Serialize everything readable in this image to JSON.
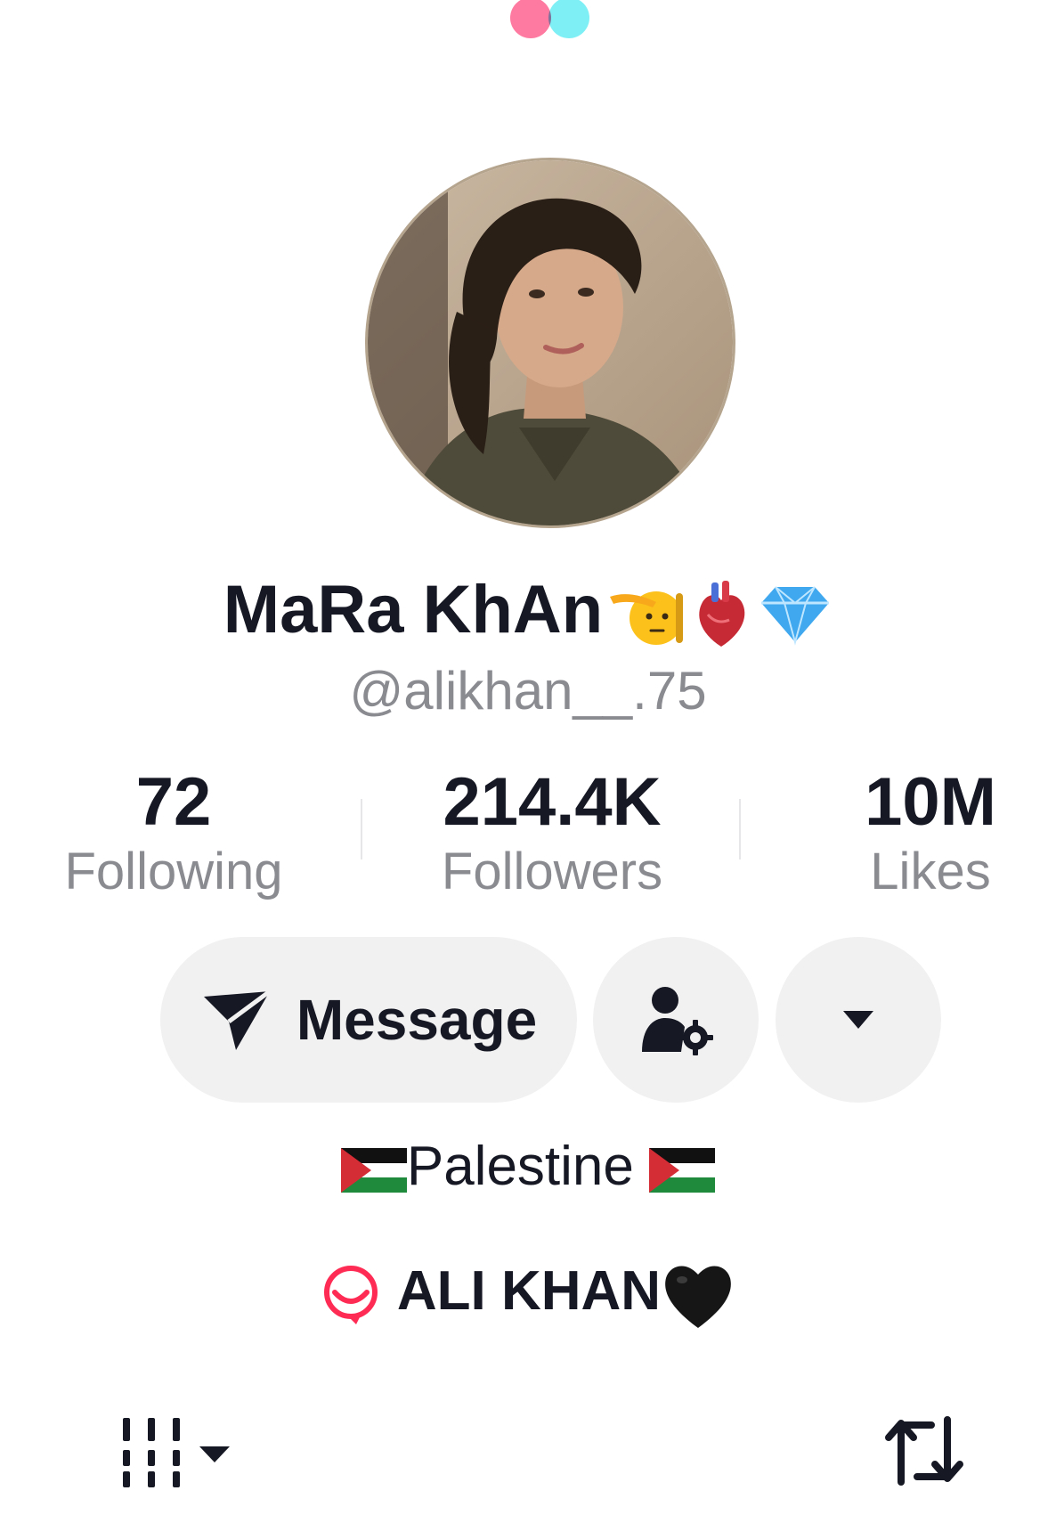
{
  "colors": {
    "loader_pink": "#fe7aa0",
    "loader_cyan": "#7ef0f5",
    "text_primary": "#161823",
    "text_secondary": "#8a8b91",
    "button_bg": "#f1f1f2",
    "link_icon": "#fe2c55"
  },
  "profile": {
    "display_name": "MaRa KhAn",
    "display_name_emojis": [
      "saluting-face",
      "anatomical-heart",
      "gem-stone"
    ],
    "username": "@alikhan__.75"
  },
  "stats": [
    {
      "value": "72",
      "label": "Following"
    },
    {
      "value": "214.4K",
      "label": "Followers"
    },
    {
      "value": "10M",
      "label": "Likes"
    }
  ],
  "actions": {
    "message_label": "Message",
    "message_icon": "paper-plane-icon",
    "manage_icon": "person-gear-icon",
    "more_icon": "caret-down-icon"
  },
  "bio": {
    "text": "Palestine",
    "flag_icon": "palestine-flag"
  },
  "link": {
    "icon": "lemon8-icon",
    "text": "ALI KHAN",
    "trailing_emoji": "black-heart"
  },
  "bottom_bar": {
    "left_icon": "grid-sort-icon",
    "right_icon": "repost-icon"
  }
}
